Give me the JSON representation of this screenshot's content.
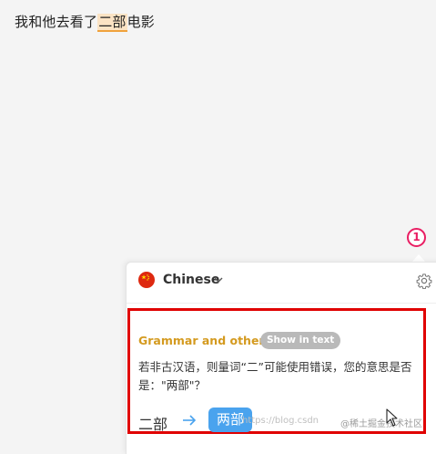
{
  "editor": {
    "before": "我和他去看了",
    "highlight": "二部",
    "after": "电影"
  },
  "step_badge": "1",
  "panel": {
    "language": "Chinese",
    "flag_icon": "china-flag-icon",
    "chevron_icon": "chevron-down-icon",
    "settings_icon": "gear-icon"
  },
  "suggestion": {
    "title": "Grammar and others",
    "show_in_text": "Show in text",
    "message": "若非古汉语，则量词“二”可能使用错误，您的意思是否是：\"两部\"？",
    "original": "二部",
    "replacement": "两部",
    "arrow_icon": "arrow-right-icon"
  },
  "watermark": {
    "left": "https://blog.csdn",
    "right": "@稀土掘金技术社区"
  },
  "colors": {
    "highlight_bg": "#fbe3c4",
    "badge": "#e91e63",
    "card_border": "#e00000",
    "title": "#d49a1f",
    "suggestion_btn": "#4aa3ee"
  }
}
